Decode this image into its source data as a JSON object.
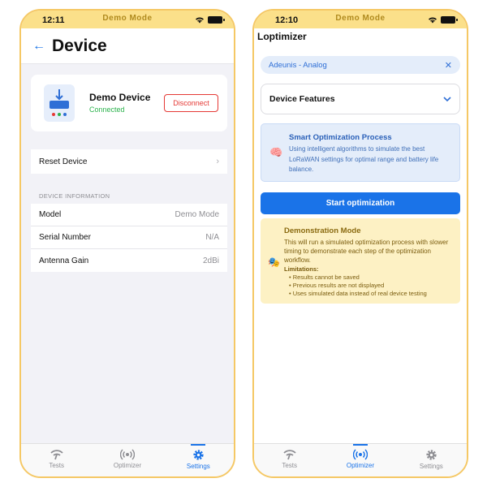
{
  "left_phone": {
    "status_bar": {
      "time": "12:11",
      "mode": "Demo Mode"
    },
    "nav_title": "Device",
    "device": {
      "name": "Demo Device",
      "status": "Connected",
      "disconnect_label": "Disconnect"
    },
    "reset_label": "Reset Device",
    "section_header": "DEVICE INFORMATION",
    "info_rows": [
      {
        "key": "Model",
        "value": "Demo Mode"
      },
      {
        "key": "Serial Number",
        "value": "N/A"
      },
      {
        "key": "Antenna Gain",
        "value": "2dBi"
      }
    ],
    "tabs": [
      {
        "label": "Tests",
        "icon": "signal-icon",
        "active": false
      },
      {
        "label": "Optimizer",
        "icon": "radio-waves-icon",
        "active": false
      },
      {
        "label": "Settings",
        "icon": "gear-icon",
        "active": true
      }
    ]
  },
  "right_phone": {
    "status_bar": {
      "time": "12:10",
      "mode": "Demo Mode"
    },
    "title": "Loptimizer",
    "chip": {
      "label": "Adeunis - Analog",
      "close_icon": "close-icon"
    },
    "features_label": "Device Features",
    "smart_card": {
      "emoji": "🧠",
      "title": "Smart Optimization Process",
      "text": "Using intelligent algorithms to simulate the best LoRaWAN settings for optimal range and battery life balance."
    },
    "start_label": "Start optimization",
    "demo_card": {
      "emoji": "🎭",
      "title": "Demonstration Mode",
      "text": "This will run a simulated optimization process with slower timing to demonstrate each step of the optimization workflow.",
      "limitations_label": "Limitations:",
      "limitations": [
        "Results cannot be saved",
        "Previous results are not displayed",
        "Uses simulated data instead of real device testing"
      ]
    },
    "tabs": [
      {
        "label": "Tests",
        "icon": "signal-icon",
        "active": false
      },
      {
        "label": "Optimizer",
        "icon": "radio-waves-icon",
        "active": true
      },
      {
        "label": "Settings",
        "icon": "gear-icon",
        "active": false
      }
    ]
  },
  "colors": {
    "accent": "#1a73e8",
    "demo_bar": "#fbe08a",
    "success": "#2bb24c",
    "danger": "#e53935"
  }
}
